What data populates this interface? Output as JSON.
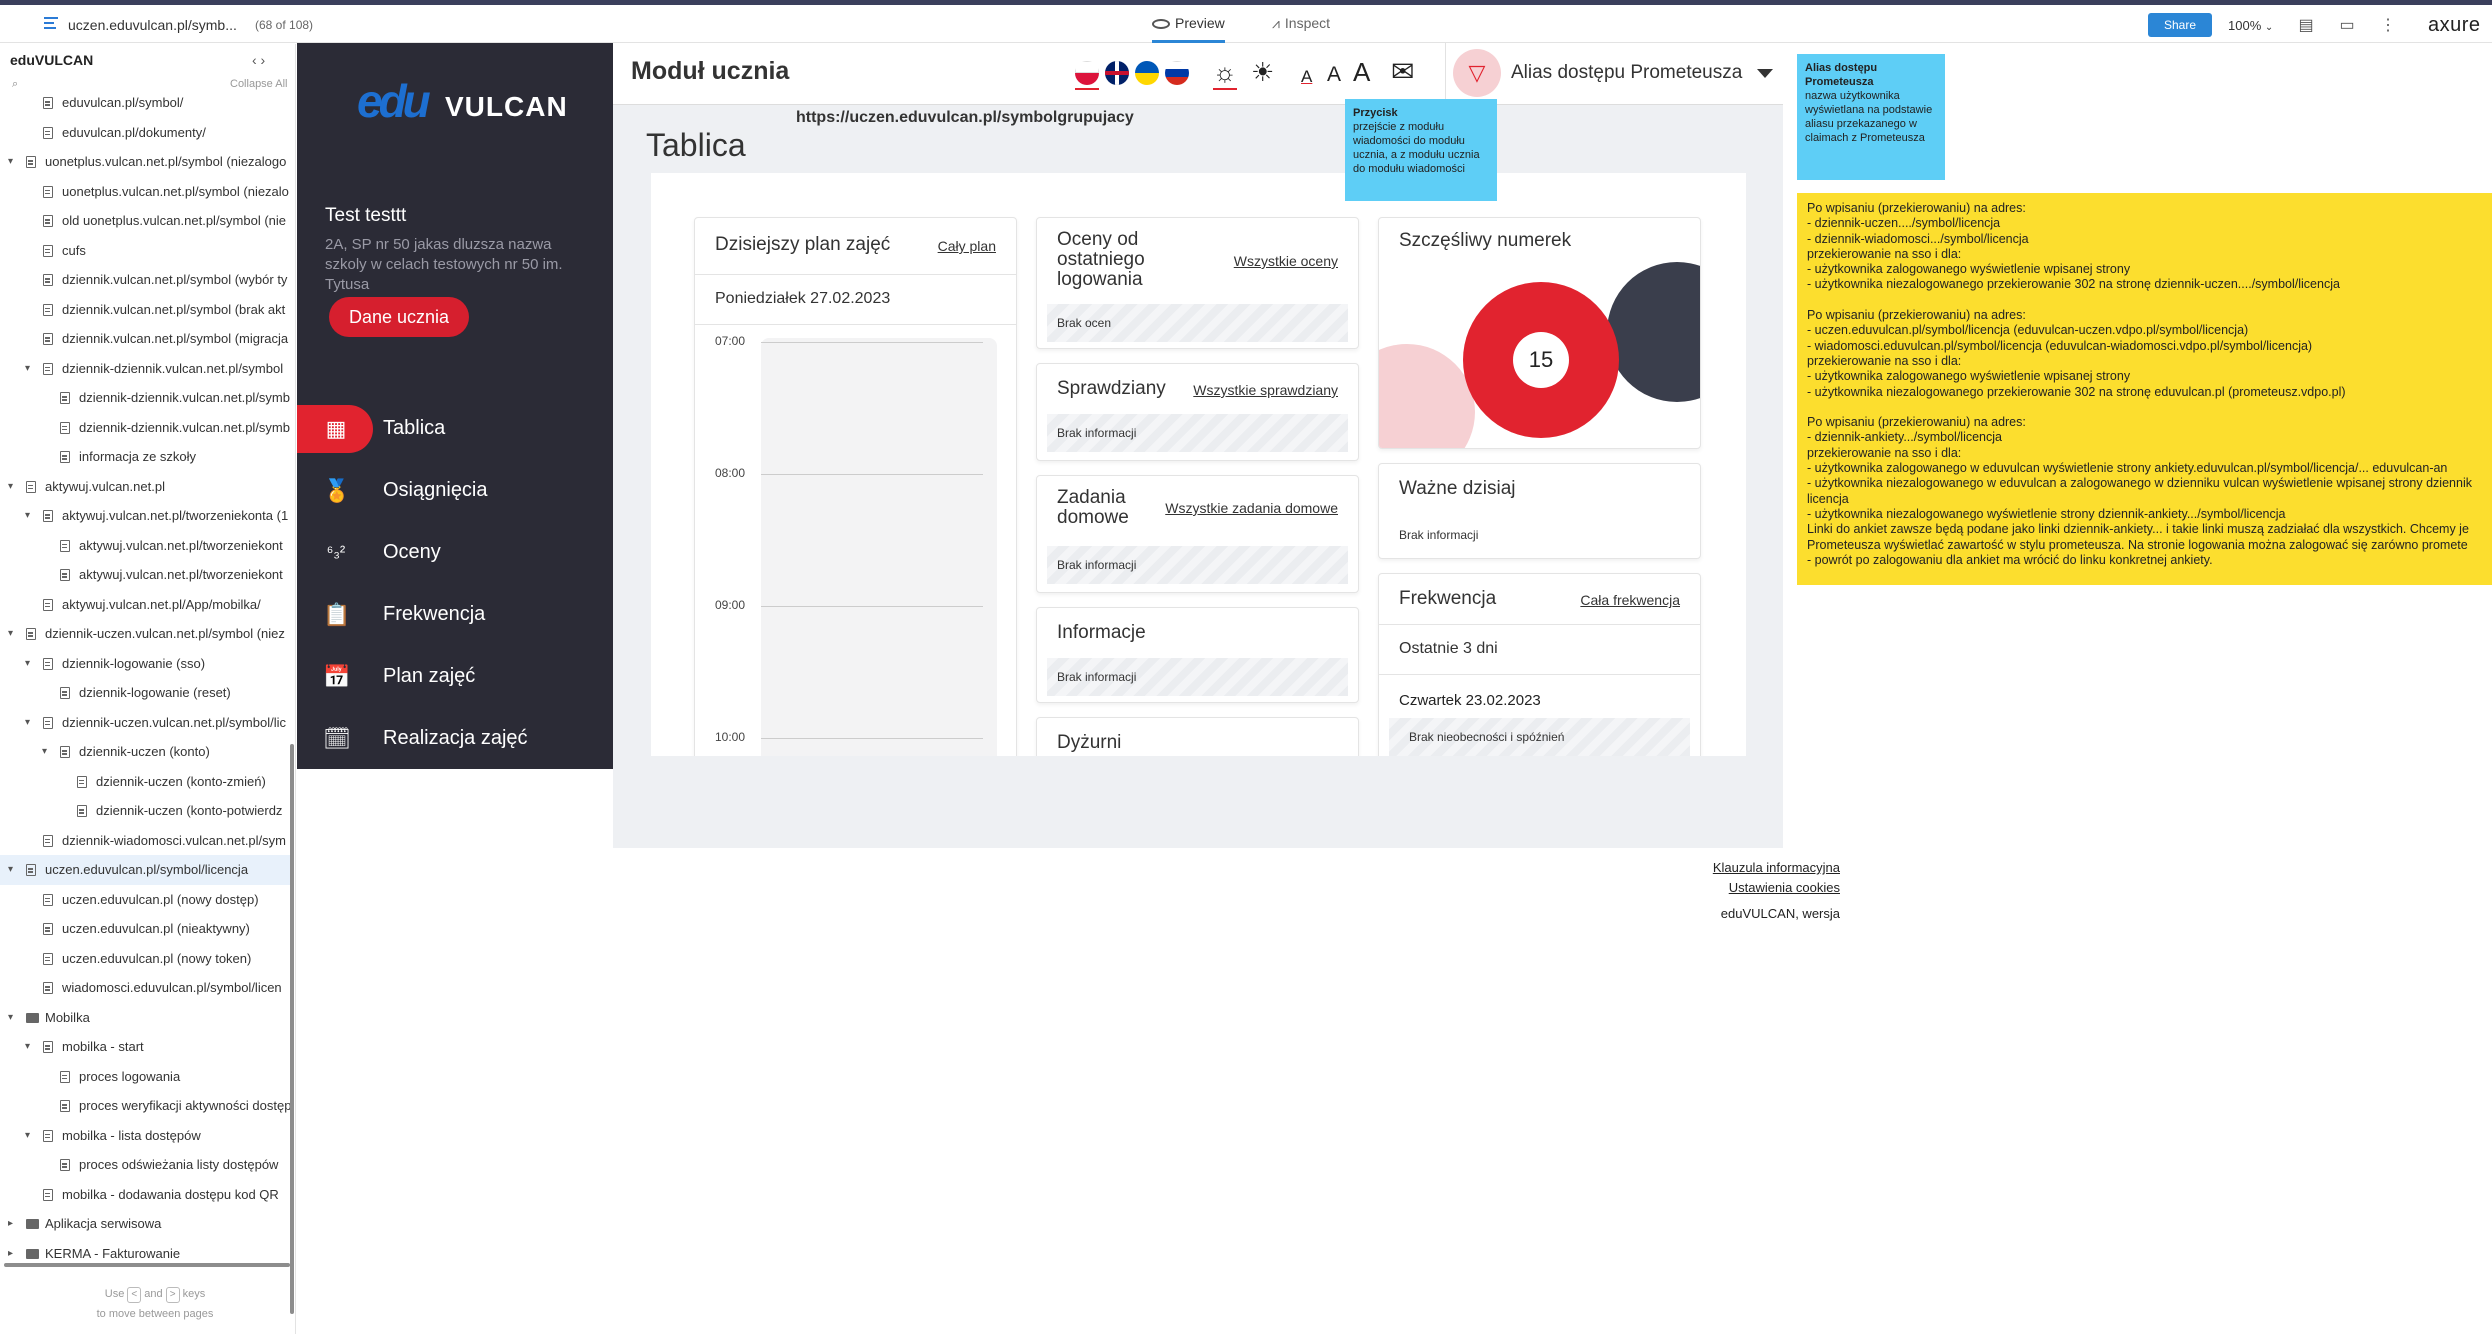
{
  "axure": {
    "page_name": "uczen.eduvulcan.pl/symb...",
    "page_count": "(68 of 108)",
    "tab_preview": "Preview",
    "tab_inspect": "Inspect",
    "share": "Share",
    "zoom": "100%",
    "logo": "axure"
  },
  "sitemap": {
    "title": "eduVULCAN",
    "nav": "‹  ›",
    "collapse_all": "Collapse All",
    "items": [
      {
        "label": "eduvulcan.pl/symbol/",
        "level": 2,
        "type": "page"
      },
      {
        "label": "eduvulcan.pl/dokumenty/",
        "level": 2,
        "type": "page"
      },
      {
        "label": "uonetplus.vulcan.net.pl/symbol (niezalogo",
        "level": 1,
        "type": "page",
        "arrow": true
      },
      {
        "label": "uonetplus.vulcan.net.pl/symbol (niezalo",
        "level": 2,
        "type": "page"
      },
      {
        "label": "old uonetplus.vulcan.net.pl/symbol (nie",
        "level": 2,
        "type": "page"
      },
      {
        "label": "cufs",
        "level": 2,
        "type": "page"
      },
      {
        "label": "dziennik.vulcan.net.pl/symbol (wybór ty",
        "level": 2,
        "type": "page"
      },
      {
        "label": "dziennik.vulcan.net.pl/symbol (brak akt",
        "level": 2,
        "type": "page"
      },
      {
        "label": "dziennik.vulcan.net.pl/symbol (migracja",
        "level": 2,
        "type": "page"
      },
      {
        "label": "dziennik-dziennik.vulcan.net.pl/symbol",
        "level": 2,
        "type": "page",
        "arrow": true
      },
      {
        "label": "dziennik-dziennik.vulcan.net.pl/symb",
        "level": 3,
        "type": "page"
      },
      {
        "label": "dziennik-dziennik.vulcan.net.pl/symb",
        "level": 3,
        "type": "page"
      },
      {
        "label": "informacja ze szkoły",
        "level": 3,
        "type": "page"
      },
      {
        "label": "aktywuj.vulcan.net.pl",
        "level": 1,
        "type": "page",
        "arrow": true
      },
      {
        "label": "aktywuj.vulcan.net.pl/tworzeniekonta (1",
        "level": 2,
        "type": "page",
        "arrow": true
      },
      {
        "label": "aktywuj.vulcan.net.pl/tworzeniekont",
        "level": 3,
        "type": "page"
      },
      {
        "label": "aktywuj.vulcan.net.pl/tworzeniekont",
        "level": 3,
        "type": "page"
      },
      {
        "label": "aktywuj.vulcan.net.pl/App/mobilka/",
        "level": 2,
        "type": "page"
      },
      {
        "label": "dziennik-uczen.vulcan.net.pl/symbol (niez",
        "level": 1,
        "type": "page",
        "arrow": true
      },
      {
        "label": "dziennik-logowanie (sso)",
        "level": 2,
        "type": "page",
        "arrow": true
      },
      {
        "label": "dziennik-logowanie (reset)",
        "level": 3,
        "type": "page"
      },
      {
        "label": "dziennik-uczen.vulcan.net.pl/symbol/lic",
        "level": 2,
        "type": "page",
        "arrow": true
      },
      {
        "label": "dziennik-uczen (konto)",
        "level": 3,
        "type": "page",
        "arrow": true
      },
      {
        "label": "dziennik-uczen (konto-zmień)",
        "level": 4,
        "type": "page"
      },
      {
        "label": "dziennik-uczen (konto-potwierdz",
        "level": 4,
        "type": "page"
      },
      {
        "label": "dziennik-wiadomosci.vulcan.net.pl/sym",
        "level": 2,
        "type": "page"
      },
      {
        "label": "uczen.eduvulcan.pl/symbol/licencja",
        "level": 1,
        "type": "page",
        "arrow": true,
        "selected": true
      },
      {
        "label": "uczen.eduvulcan.pl (nowy dostęp)",
        "level": 2,
        "type": "page"
      },
      {
        "label": "uczen.eduvulcan.pl (nieaktywny)",
        "level": 2,
        "type": "page"
      },
      {
        "label": "uczen.eduvulcan.pl (nowy token)",
        "level": 2,
        "type": "page"
      },
      {
        "label": "wiadomosci.eduvulcan.pl/symbol/licen",
        "level": 2,
        "type": "page"
      },
      {
        "label": "Mobilka",
        "level": 1,
        "type": "folder",
        "arrow": true
      },
      {
        "label": "mobilka - start",
        "level": 2,
        "type": "page",
        "arrow": true
      },
      {
        "label": "proces logowania",
        "level": 3,
        "type": "page"
      },
      {
        "label": "proces weryfikacji aktywności dostęp",
        "level": 3,
        "type": "page"
      },
      {
        "label": "mobilka - lista dostępów",
        "level": 2,
        "type": "page",
        "arrow": true
      },
      {
        "label": "proces odświeżania listy dostępów",
        "level": 3,
        "type": "page"
      },
      {
        "label": "mobilka - dodawania dostępu kod QR",
        "level": 2,
        "type": "page"
      },
      {
        "label": "Aplikacja serwisowa",
        "level": 1,
        "type": "folder",
        "arrow": true,
        "collapsed": true
      },
      {
        "label": "KERMA - Fakturowanie",
        "level": 1,
        "type": "folder",
        "arrow": true,
        "collapsed": true
      }
    ],
    "hint_use": "Use",
    "hint_and": "and",
    "hint_keys": "keys",
    "hint_line2": "to move between pages"
  },
  "app": {
    "brand_edu": "edu",
    "brand_vulcan": "VULCAN",
    "student_name": "Test testtt",
    "student_class": "2A, SP nr 50 jakas dluzsza nazwa szkoly w celach testowych nr 50 im. Tytusa",
    "dane_button": "Dane ucznia",
    "menu": [
      {
        "label": "Tablica",
        "icon": "dashboard-icon",
        "glyph": "▦",
        "active": true
      },
      {
        "label": "Osiągnięcia",
        "icon": "medal-icon",
        "glyph": "🏅"
      },
      {
        "label": "Oceny",
        "icon": "grades-icon",
        "glyph": "⁶₃²"
      },
      {
        "label": "Frekwencja",
        "icon": "attendance-icon",
        "glyph": "📋"
      },
      {
        "label": "Plan zajęć",
        "icon": "calendar-icon",
        "glyph": "📅"
      },
      {
        "label": "Realizacja zajęć",
        "icon": "calendar-clock-icon",
        "glyph": "🗓"
      }
    ],
    "module_title": "Moduł ucznia",
    "font_small": "A",
    "font_mid": "A",
    "font_large": "A",
    "alias": "Alias dostępu Prometeusza",
    "url": "https://uczen.eduvulcan.pl/symbolgrupujacy",
    "page_title": "Tablica",
    "cards": {
      "plan": {
        "title": "Dzisiejszy plan zajęć",
        "link": "Cały plan",
        "date": "Poniedziałek 27.02.2023",
        "hours": [
          "07:00",
          "08:00",
          "09:00",
          "10:00"
        ]
      },
      "oceny": {
        "title": "Oceny od ostatniego logowania",
        "link": "Wszystkie oceny",
        "empty": "Brak ocen"
      },
      "sprawdziany": {
        "title": "Sprawdziany",
        "link": "Wszystkie sprawdziany",
        "empty": "Brak informacji"
      },
      "zadania": {
        "title": "Zadania domowe",
        "link": "Wszystkie zadania domowe",
        "empty": "Brak informacji"
      },
      "informacje": {
        "title": "Informacje",
        "empty": "Brak informacji"
      },
      "dyzurni": {
        "title": "Dyżurni"
      },
      "numerek": {
        "title": "Szczęśliwy numerek",
        "value": "15"
      },
      "wazne": {
        "title": "Ważne dzisiaj",
        "empty": "Brak informacji"
      },
      "frekwencja": {
        "title": "Frekwencja",
        "link": "Cała frekwencja",
        "range": "Ostatnie 3 dni",
        "day": "Czwartek 23.02.2023",
        "status": "Brak nieobecności i spóźnień"
      }
    },
    "footer": {
      "clause": "Klauzula informacyjna",
      "cookies": "Ustawienia cookies",
      "version": "eduVULCAN, wersja"
    }
  },
  "annotations": {
    "przycisk_title": "Przycisk",
    "przycisk_body": "przejście z modułu wiadomości do modułu ucznia, a z modułu ucznia do modułu wiadomości",
    "alias_title": "Alias dostępu Prometeusza",
    "alias_body": "nazwa użytkownika wyświetlana na podstawie aliasu przekazanego w claimach z Prometeusza",
    "yellow_lines": [
      "Po wpisaniu (przekierowaniu) na adres:",
      "- dziennik-uczen..../symbol/licencja",
      "- dziennik-wiadomosci.../symbol/licencja",
      "przekierowanie na sso i dla:",
      "- użytkownika zalogowanego wyświetlenie wpisanej strony",
      "- użytkownika niezalogowanego przekierowanie 302 na stronę dziennik-uczen..../symbol/licencja",
      "",
      "Po wpisaniu (przekierowaniu) na adres:",
      "- uczen.eduvulcan.pl/symbol/licencja (eduvulcan-uczen.vdpo.pl/symbol/licencja)",
      "- wiadomosci.eduvulcan.pl/symbol/licencja (eduvulcan-wiadomosci.vdpo.pl/symbol/licencja)",
      "przekierowanie na sso i dla:",
      "- użytkownika zalogowanego wyświetlenie wpisanej strony",
      "- użytkownika niezalogowanego przekierowanie 302 na stronę eduvulcan.pl (prometeusz.vdpo.pl)",
      "",
      "Po wpisaniu (przekierowaniu) na adres:",
      "- dziennik-ankiety.../symbol/licencja",
      "przekierowanie na sso i dla:",
      "- użytkownika zalogowanego w eduvulcan wyświetlenie strony ankiety.eduvulcan.pl/symbol/licencja/... eduvulcan-an",
      "- użytkownika niezalogowanego w eduvulcan a zalogowanego w dzienniku vulcan wyświetlenie wpisanej strony dziennik",
      "licencja",
      "- użytkownika niezalogowanego wyświetlenie strony dziennik-ankiety.../symbol/licencja",
      "Linki do ankiet zawsze będą podane jako linki dziennik-ankiety... i takie linki muszą zadziałać dla wszystkich. Chcemy je",
      "Prometeusza wyświetlać zawartość w stylu prometeusza. Na stronie logowania można zalogować się zarówno promete",
      "- powrót po zalogowaniu dla ankiet ma wrócić do linku konkretnej ankiety."
    ]
  },
  "colors": {
    "accent_red": "#e1232f",
    "sidebar_dark": "#2b2b36",
    "note_blue": "#5ecef6",
    "note_yellow": "#fcde2e",
    "axure_blue": "#2b86d6"
  }
}
